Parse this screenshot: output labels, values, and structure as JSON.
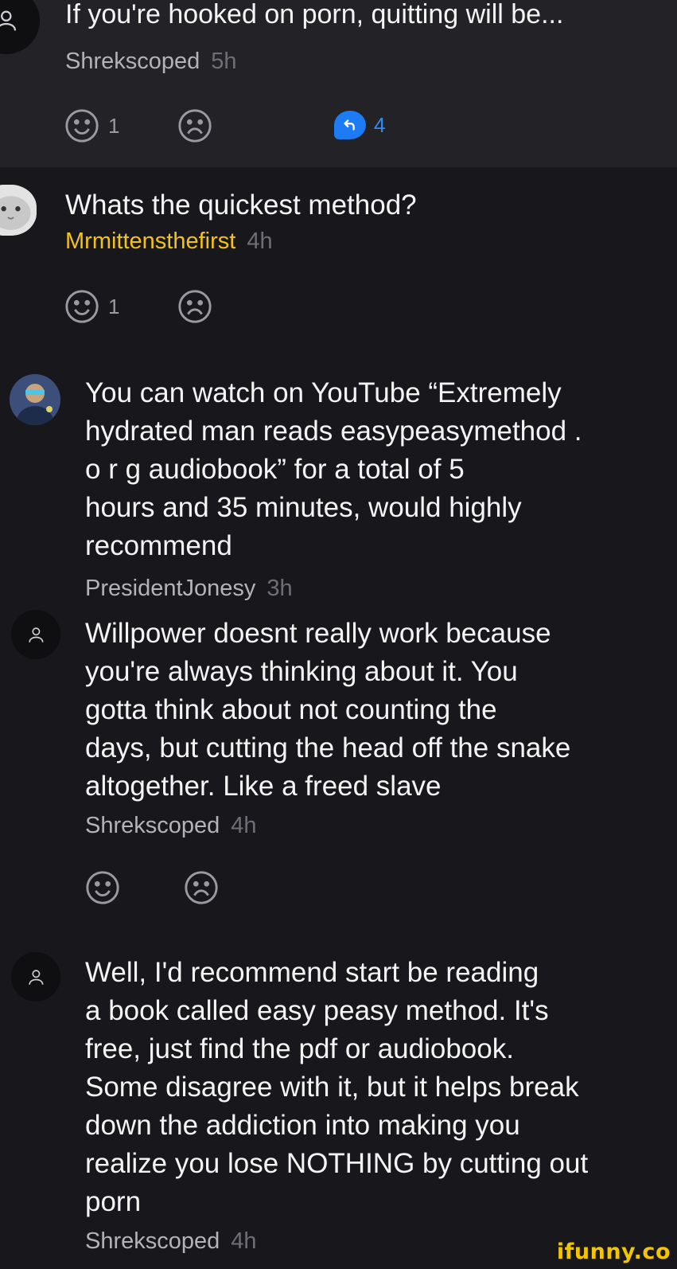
{
  "colors": {
    "background": "#18181c",
    "top_panel": "#232327",
    "username_gold": "#f1c21b",
    "reply_blue": "#1b7cf5",
    "watermark": "#f3c400"
  },
  "post": {
    "title": "If you're hooked on porn, quitting will be...",
    "author": "Shrekscoped",
    "time": "5h",
    "smile_count": "1",
    "replies_count": "4",
    "icons": [
      "user-placeholder-icon",
      "smile-icon",
      "frown-icon",
      "reply-icon"
    ]
  },
  "comments": [
    {
      "text": "Whats the quickest method?",
      "author": "Mrmittensthefirst",
      "author_color": "#f1c21b",
      "time": "4h",
      "smile_count": "1"
    },
    {
      "lines": [
        "You can watch on YouTube “Extremely",
        "hydrated man reads easypeasymethod .",
        "o r g audiobook” for a total of 5",
        "hours and 35 minutes, would highly",
        "recommend"
      ],
      "author": "PresidentJonesy",
      "time": "3h"
    },
    {
      "lines": [
        "Willpower doesnt really work because",
        "you're always thinking about it. You",
        "gotta think about not counting the",
        "days, but cutting the head off the snake",
        "altogether. Like a freed slave"
      ],
      "author": "Shrekscoped",
      "time": "4h"
    },
    {
      "lines": [
        "Well, I'd recommend start be reading",
        "a book called easy peasy method. It's",
        "free, just find the pdf or audiobook.",
        "Some disagree with it, but it helps break",
        "down the addiction into making you",
        "realize you lose NOTHING by cutting out",
        "porn"
      ],
      "author": "Shrekscoped",
      "time": "4h"
    }
  ],
  "watermark": "ifunny.co"
}
